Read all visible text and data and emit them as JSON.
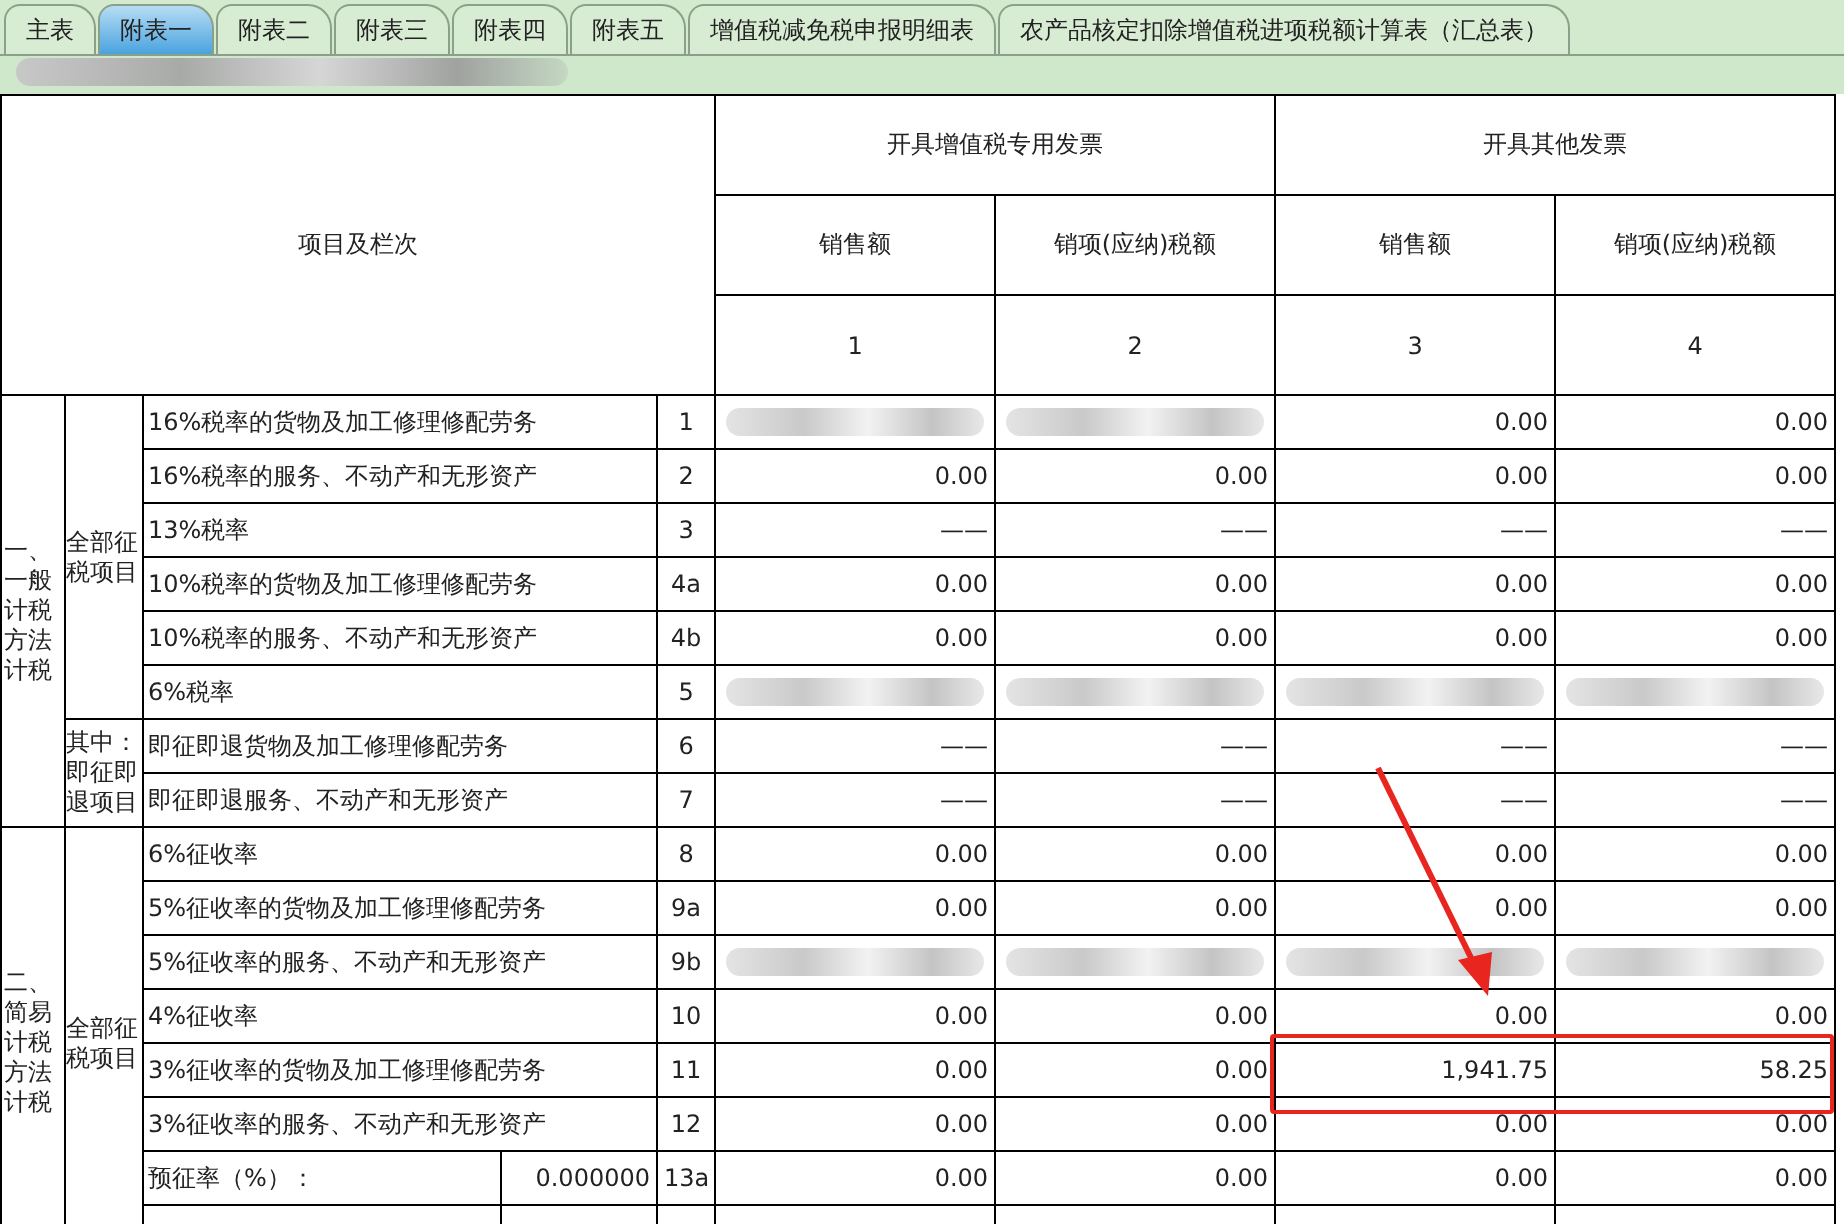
{
  "tabs": [
    {
      "label": "主表",
      "selected": false
    },
    {
      "label": "附表一",
      "selected": true
    },
    {
      "label": "附表二",
      "selected": false
    },
    {
      "label": "附表三",
      "selected": false
    },
    {
      "label": "附表四",
      "selected": false
    },
    {
      "label": "附表五",
      "selected": false
    },
    {
      "label": "增值税减免税申报明细表",
      "selected": false
    },
    {
      "label": "农产品核定扣除增值税进项税额计算表（汇总表）",
      "selected": false
    }
  ],
  "info_line": {
    "redacted": true
  },
  "table": {
    "item_header": "项目及栏次",
    "groups": [
      "开具增值税专用发票",
      "开具其他发票"
    ],
    "subcolumns": [
      "销售额",
      "销项(应纳)税额",
      "销售额",
      "销项(应纳)税额"
    ],
    "column_numbers": [
      "1",
      "2",
      "3",
      "4"
    ],
    "sections": [
      {
        "label": "一、一般计税方法计税",
        "subsections": [
          {
            "label": "全部征税项目",
            "rows": [
              {
                "item": "16%税率的货物及加工修理修配劳务",
                "line": "1",
                "values": [
                  {
                    "redacted": true
                  },
                  {
                    "redacted": true
                  },
                  {
                    "text": "0.00"
                  },
                  {
                    "text": "0.00"
                  }
                ]
              },
              {
                "item": "16%税率的服务、不动产和无形资产",
                "line": "2",
                "values": [
                  {
                    "text": "0.00"
                  },
                  {
                    "text": "0.00"
                  },
                  {
                    "text": "0.00"
                  },
                  {
                    "text": "0.00"
                  }
                ]
              },
              {
                "item": "13%税率",
                "line": "3",
                "values": [
                  {
                    "text": "——"
                  },
                  {
                    "text": "——"
                  },
                  {
                    "text": "——"
                  },
                  {
                    "text": "——"
                  }
                ]
              },
              {
                "item": "10%税率的货物及加工修理修配劳务",
                "line": "4a",
                "values": [
                  {
                    "text": "0.00"
                  },
                  {
                    "text": "0.00"
                  },
                  {
                    "text": "0.00"
                  },
                  {
                    "text": "0.00"
                  }
                ]
              },
              {
                "item": "10%税率的服务、不动产和无形资产",
                "line": "4b",
                "values": [
                  {
                    "text": "0.00"
                  },
                  {
                    "text": "0.00"
                  },
                  {
                    "text": "0.00"
                  },
                  {
                    "text": "0.00"
                  }
                ]
              },
              {
                "item": "6%税率",
                "line": "5",
                "values": [
                  {
                    "redacted": true
                  },
                  {
                    "redacted": true
                  },
                  {
                    "redacted": true
                  },
                  {
                    "redacted": true
                  }
                ]
              }
            ]
          },
          {
            "label": "其中：即征即退项目",
            "rows": [
              {
                "item": "即征即退货物及加工修理修配劳务",
                "line": "6",
                "values": [
                  {
                    "text": "——"
                  },
                  {
                    "text": "——"
                  },
                  {
                    "text": "——"
                  },
                  {
                    "text": "——"
                  }
                ]
              },
              {
                "item": "即征即退服务、不动产和无形资产",
                "line": "7",
                "values": [
                  {
                    "text": "——"
                  },
                  {
                    "text": "——"
                  },
                  {
                    "text": "——"
                  },
                  {
                    "text": "——"
                  }
                ]
              }
            ]
          }
        ]
      },
      {
        "label": "二、简易计税方法计税",
        "subsections": [
          {
            "label": "全部征税项目",
            "rows": [
              {
                "item": "6%征收率",
                "line": "8",
                "values": [
                  {
                    "text": "0.00"
                  },
                  {
                    "text": "0.00"
                  },
                  {
                    "text": "0.00"
                  },
                  {
                    "text": "0.00"
                  }
                ]
              },
              {
                "item": "5%征收率的货物及加工修理修配劳务",
                "line": "9a",
                "values": [
                  {
                    "text": "0.00"
                  },
                  {
                    "text": "0.00"
                  },
                  {
                    "text": "0.00"
                  },
                  {
                    "text": "0.00"
                  }
                ]
              },
              {
                "item": "5%征收率的服务、不动产和无形资产",
                "line": "9b",
                "values": [
                  {
                    "redacted": true
                  },
                  {
                    "redacted": true
                  },
                  {
                    "redacted": true
                  },
                  {
                    "redacted": true
                  }
                ]
              },
              {
                "item": "4%征收率",
                "line": "10",
                "values": [
                  {
                    "text": "0.00"
                  },
                  {
                    "text": "0.00"
                  },
                  {
                    "text": "0.00"
                  },
                  {
                    "text": "0.00"
                  }
                ]
              },
              {
                "item": "3%征收率的货物及加工修理修配劳务",
                "line": "11",
                "values": [
                  {
                    "text": "0.00"
                  },
                  {
                    "text": "0.00"
                  },
                  {
                    "text": "1,941.75"
                  },
                  {
                    "text": "58.25"
                  }
                ],
                "highlighted": true
              },
              {
                "item": "3%征收率的服务、不动产和无形资产",
                "line": "12",
                "values": [
                  {
                    "text": "0.00"
                  },
                  {
                    "text": "0.00"
                  },
                  {
                    "text": "0.00"
                  },
                  {
                    "text": "0.00"
                  }
                ]
              },
              {
                "item": "预征率（%）：",
                "rate": "0.000000",
                "line": "13a",
                "values": [
                  {
                    "text": "0.00"
                  },
                  {
                    "text": "0.00"
                  },
                  {
                    "text": "0.00"
                  },
                  {
                    "text": "0.00"
                  }
                ]
              }
            ]
          }
        ]
      }
    ]
  }
}
